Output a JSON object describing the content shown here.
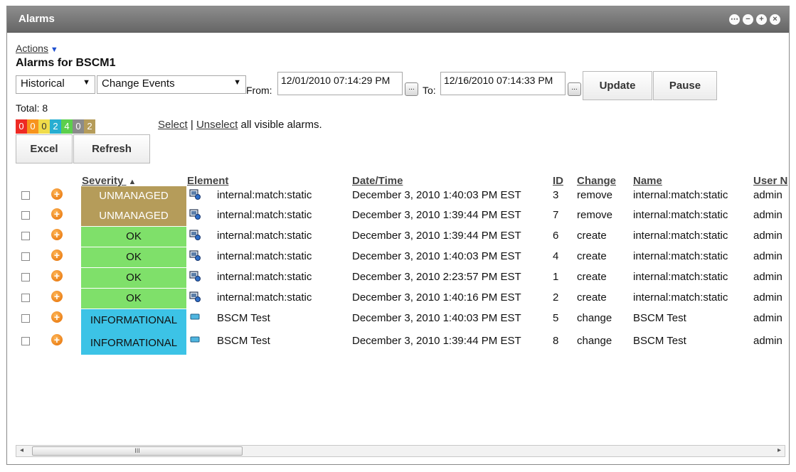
{
  "window": {
    "title": "Alarms",
    "controls": [
      "⋯",
      "−",
      "+",
      "×"
    ]
  },
  "actions_label": "Actions",
  "page_title": "Alarms for BSCM1",
  "filters": {
    "mode_value": "Historical",
    "type_value": "Change Events",
    "from_label": "From:",
    "from_value": "12/01/2010 07:14:29 PM",
    "to_label": "To:",
    "to_value": "12/16/2010 07:14:33 PM",
    "picker_label": "...",
    "update_label": "Update",
    "pause_label": "Pause"
  },
  "total_label": "Total: 8",
  "severity_counts": [
    {
      "value": "0",
      "color": "#ee2a24"
    },
    {
      "value": "0",
      "color": "#f7941d"
    },
    {
      "value": "0",
      "color": "#f0dc4a"
    },
    {
      "value": "2",
      "color": "#27aed1"
    },
    {
      "value": "4",
      "color": "#5ccf4c"
    },
    {
      "value": "0",
      "color": "#8b8b8b"
    },
    {
      "value": "2",
      "color": "#b59c5a"
    }
  ],
  "selection": {
    "select_label": "Select",
    "separator": "|",
    "unselect_label": "Unselect",
    "suffix": "all visible alarms."
  },
  "buttons": {
    "excel_label": "Excel",
    "refresh_label": "Refresh"
  },
  "table": {
    "columns": {
      "severity": "Severity",
      "severity_sort": "▲",
      "element": "Element",
      "datetime": "Date/Time",
      "id": "ID",
      "change": "Change",
      "name": "Name",
      "user": "User N"
    },
    "rows": [
      {
        "severity": "UNMANAGED",
        "sev_color": "#b59c5a",
        "sev_text_color": "#ffffff",
        "element_icon": "managed-element-icon",
        "element": "internal:match:static",
        "datetime": "December 3, 2010 1:40:03 PM EST",
        "id": "3",
        "change": "remove",
        "name": "internal:match:static",
        "user": "admin"
      },
      {
        "severity": "UNMANAGED",
        "sev_color": "#b59c5a",
        "sev_text_color": "#ffffff",
        "element_icon": "managed-element-icon",
        "element": "internal:match:static",
        "datetime": "December 3, 2010 1:39:44 PM EST",
        "id": "7",
        "change": "remove",
        "name": "internal:match:static",
        "user": "admin"
      },
      {
        "severity": "OK",
        "sev_color": "#7fe06a",
        "sev_text_color": "#111111",
        "element_icon": "managed-element-icon",
        "element": "internal:match:static",
        "datetime": "December 3, 2010 1:39:44 PM EST",
        "id": "6",
        "change": "create",
        "name": "internal:match:static",
        "user": "admin"
      },
      {
        "severity": "OK",
        "sev_color": "#7fe06a",
        "sev_text_color": "#111111",
        "element_icon": "managed-element-icon",
        "element": "internal:match:static",
        "datetime": "December 3, 2010 1:40:03 PM EST",
        "id": "4",
        "change": "create",
        "name": "internal:match:static",
        "user": "admin"
      },
      {
        "severity": "OK",
        "sev_color": "#7fe06a",
        "sev_text_color": "#111111",
        "element_icon": "managed-element-icon",
        "element": "internal:match:static",
        "datetime": "December 3, 2010 2:23:57 PM EST",
        "id": "1",
        "change": "create",
        "name": "internal:match:static",
        "user": "admin"
      },
      {
        "severity": "OK",
        "sev_color": "#7fe06a",
        "sev_text_color": "#111111",
        "element_icon": "managed-element-icon",
        "element": "internal:match:static",
        "datetime": "December 3, 2010 1:40:16 PM EST",
        "id": "2",
        "change": "create",
        "name": "internal:match:static",
        "user": "admin"
      },
      {
        "severity": "INFORMATIONAL",
        "sev_color": "#3cc3e6",
        "sev_text_color": "#111111",
        "element_icon": "monitor-element-icon",
        "element": "BSCM Test",
        "datetime": "December 3, 2010 1:40:03 PM EST",
        "id": "5",
        "change": "change",
        "name": "BSCM Test",
        "user": "admin"
      },
      {
        "severity": "INFORMATIONAL",
        "sev_color": "#3cc3e6",
        "sev_text_color": "#111111",
        "element_icon": "monitor-element-icon",
        "element": "BSCM Test",
        "datetime": "December 3, 2010 1:39:44 PM EST",
        "id": "8",
        "change": "change",
        "name": "BSCM Test",
        "user": "admin"
      }
    ]
  },
  "scrollbar": {
    "left_arrow": "◂",
    "right_arrow": "▸",
    "grip": "III"
  }
}
